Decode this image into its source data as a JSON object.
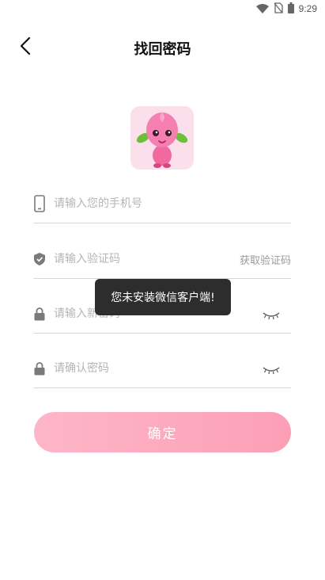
{
  "status_bar": {
    "time": "9:29",
    "icons": [
      "wifi-icon",
      "no-sim-icon",
      "battery-icon"
    ]
  },
  "header": {
    "title": "找回密码",
    "back_icon": "chevron-left-icon"
  },
  "logo": {
    "icon": "mascot-logo-icon",
    "background": "#fbe0ec"
  },
  "form": {
    "phone": {
      "placeholder": "请输入您的手机号",
      "value": "",
      "icon": "phone-icon"
    },
    "code": {
      "placeholder": "请输入验证码",
      "value": "",
      "icon": "shield-check-icon",
      "action_label": "获取验证码"
    },
    "new_password": {
      "placeholder": "请输入新密码",
      "value": "",
      "icon": "lock-icon",
      "toggle_icon": "eye-closed-icon"
    },
    "confirm_password": {
      "placeholder": "请确认密码",
      "value": "",
      "icon": "lock-icon",
      "toggle_icon": "eye-closed-icon"
    }
  },
  "confirm_button": {
    "label": "确定"
  },
  "toast": {
    "message": "您未安装微信客户端!"
  },
  "colors": {
    "accent_start": "#fdb6c8",
    "accent_end": "#fc9fb6",
    "toast_bg": "#2d2d2d"
  }
}
